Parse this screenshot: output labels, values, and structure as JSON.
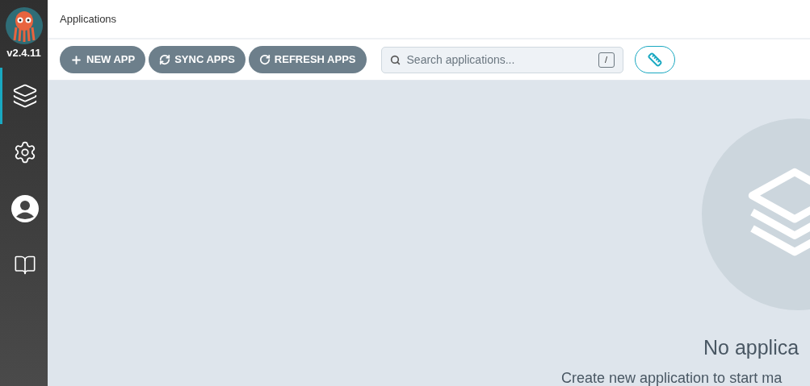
{
  "sidebar": {
    "version": "v2.4.11",
    "items": [
      {
        "kind": "applications",
        "selected": true
      },
      {
        "kind": "settings",
        "selected": false
      },
      {
        "kind": "user",
        "selected": false
      },
      {
        "kind": "docs",
        "selected": false
      }
    ]
  },
  "header": {
    "title": "Applications"
  },
  "toolbar": {
    "buttons": [
      {
        "kind": "new",
        "label": "NEW APP"
      },
      {
        "kind": "sync",
        "label": "SYNC APPS"
      },
      {
        "kind": "refresh",
        "label": "REFRESH APPS"
      }
    ],
    "search": {
      "placeholder": "Search applications...",
      "shortcut": "/"
    }
  },
  "empty_state": {
    "title": "No applica",
    "subtitle": "Create new application to start ma"
  }
}
